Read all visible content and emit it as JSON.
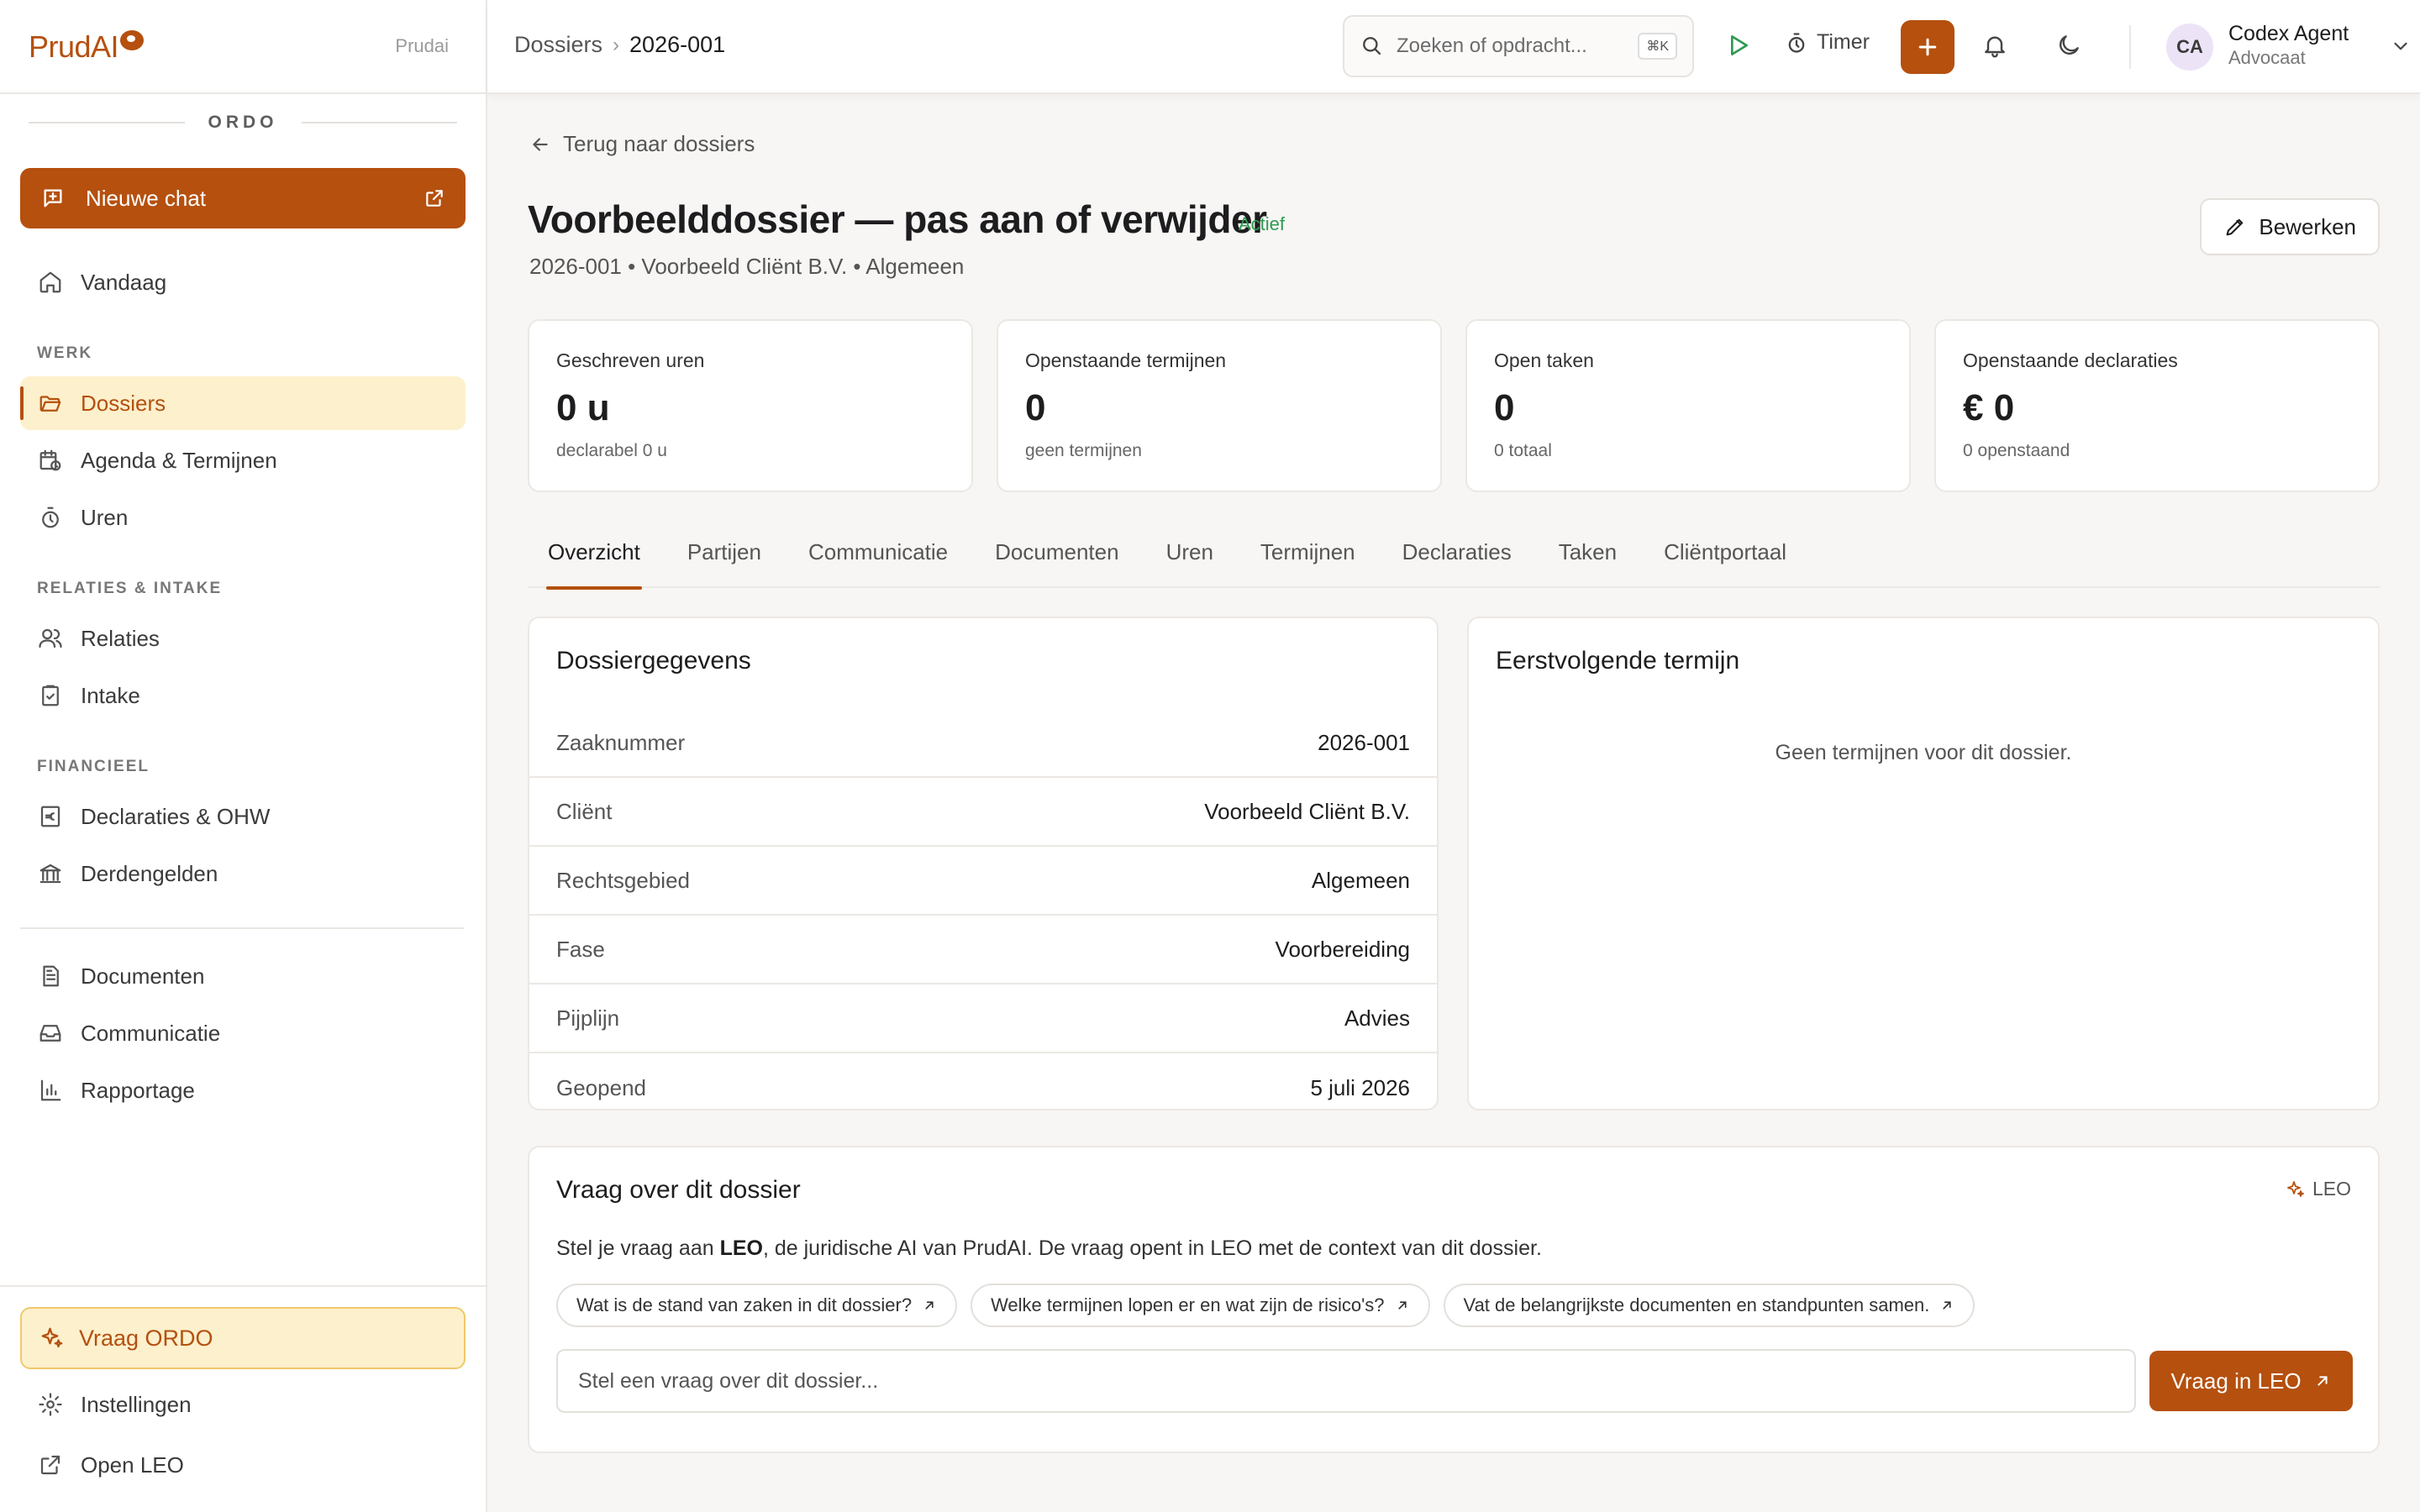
{
  "brand": {
    "name": "PrudAI",
    "tag": "Prudai",
    "accent": "#b5500f"
  },
  "sidebar": {
    "section_title": "ORDO",
    "new_chat": "Nieuwe chat",
    "today": "Vandaag",
    "sections": {
      "werk": "WERK",
      "relaties": "RELATIES & INTAKE",
      "financieel": "FINANCIEEL"
    },
    "items": {
      "dossiers": "Dossiers",
      "agenda": "Agenda & Termijnen",
      "uren": "Uren",
      "relaties": "Relaties",
      "intake": "Intake",
      "declaraties": "Declaraties & OHW",
      "derdengelden": "Derdengelden",
      "documenten": "Documenten",
      "communicatie": "Communicatie",
      "rapportage": "Rapportage"
    },
    "ask_ordo": "Vraag ORDO",
    "settings": "Instellingen",
    "open_leo": "Open LEO"
  },
  "topbar": {
    "breadcrumb": [
      "Dossiers",
      "2026-001"
    ],
    "search_placeholder": "Zoeken of opdracht...",
    "search_shortcut": "⌘K",
    "timer": "Timer",
    "user": {
      "initials": "CA",
      "name": "Codex Agent",
      "role": "Advocaat"
    }
  },
  "page": {
    "back": "Terug naar dossiers",
    "title": "Voorbeelddossier — pas aan of verwijder",
    "status": "Actief",
    "subtitle": "2026-001 • Voorbeeld Cliënt B.V. • Algemeen",
    "edit": "Bewerken"
  },
  "stats": [
    {
      "label": "Geschreven uren",
      "value": "0 u",
      "sub": "declarabel 0 u"
    },
    {
      "label": "Openstaande termijnen",
      "value": "0",
      "sub": "geen termijnen"
    },
    {
      "label": "Open taken",
      "value": "0",
      "sub": "0 totaal"
    },
    {
      "label": "Openstaande declaraties",
      "value": "€ 0",
      "sub": "0 openstaand"
    }
  ],
  "tabs": [
    "Overzicht",
    "Partijen",
    "Communicatie",
    "Documenten",
    "Uren",
    "Termijnen",
    "Declaraties",
    "Taken",
    "Cliëntportaal"
  ],
  "details": {
    "title": "Dossiergegevens",
    "rows": [
      {
        "k": "Zaaknummer",
        "v": "2026-001"
      },
      {
        "k": "Cliënt",
        "v": "Voorbeeld Cliënt B.V."
      },
      {
        "k": "Rechtsgebied",
        "v": "Algemeen"
      },
      {
        "k": "Fase",
        "v": "Voorbereiding"
      },
      {
        "k": "Pijplijn",
        "v": "Advies"
      },
      {
        "k": "Geopend",
        "v": "5 juli 2026"
      }
    ]
  },
  "next_deadline": {
    "title": "Eerstvolgende termijn",
    "empty": "Geen termijnen voor dit dossier."
  },
  "ask": {
    "title": "Vraag over dit dossier",
    "tag": "LEO",
    "desc_pre": "Stel je vraag aan ",
    "desc_bold": "LEO",
    "desc_post": ", de juridische AI van PrudAI. De vraag opent in LEO met de context van dit dossier.",
    "chips": [
      "Wat is de stand van zaken in dit dossier?",
      "Welke termijnen lopen er en wat zijn de risico's?",
      "Vat de belangrijkste documenten en standpunten samen."
    ],
    "placeholder": "Stel een vraag over dit dossier...",
    "button": "Vraag in LEO"
  }
}
